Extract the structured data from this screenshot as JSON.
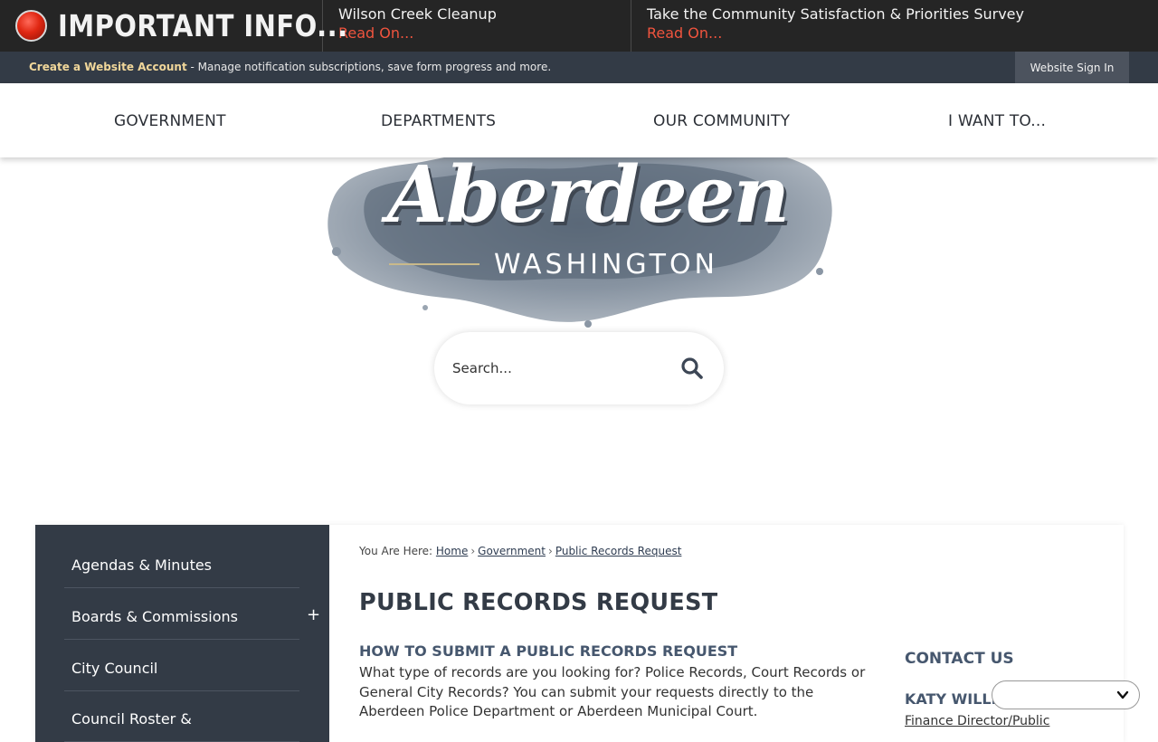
{
  "alert_bar": {
    "title": "IMPORTANT INFO...",
    "items": [
      {
        "title": "Wilson Creek Cleanup",
        "link": "Read On..."
      },
      {
        "title": "Take the Community Satisfaction & Priorities Survey",
        "link": "Read On..."
      }
    ]
  },
  "account_bar": {
    "create_link": "Create a Website Account",
    "description": " - Manage notification subscriptions, save form progress and more.",
    "signin": "Website Sign In"
  },
  "main_nav": {
    "items": [
      "GOVERNMENT",
      "DEPARTMENTS",
      "OUR COMMUNITY",
      "I WANT TO..."
    ]
  },
  "logo": {
    "wordmark": "Aberdeen",
    "subtitle": "WASHINGTON"
  },
  "search": {
    "placeholder": "Search..."
  },
  "side_nav": {
    "items": [
      {
        "label": "Agendas & Minutes"
      },
      {
        "label": "Boards & Commissions",
        "expand": "+"
      },
      {
        "label": "City Council"
      },
      {
        "label": "Council Roster &"
      }
    ]
  },
  "breadcrumb": {
    "prefix": "You Are Here:",
    "items": [
      "Home",
      "Government",
      "Public Records Request"
    ]
  },
  "page": {
    "title": "PUBLIC RECORDS REQUEST",
    "section_heading": "HOW TO SUBMIT A PUBLIC RECORDS REQUEST",
    "section_body": "What type of records are you looking for? Police Records, Court Records or General City Records? You can submit your requests directly to the Aberdeen Police Department or Aberdeen Municipal Court."
  },
  "contact": {
    "heading": "CONTACT US",
    "name": "KATY WILLIA",
    "role": "Finance Director/Public"
  },
  "colors": {
    "alert_bg": "#252525",
    "alert_link": "#f0543e",
    "account_bg": "#333b46",
    "account_link": "#f1d79a",
    "side_nav_bg": "#333b46",
    "heading": "#46576e"
  }
}
